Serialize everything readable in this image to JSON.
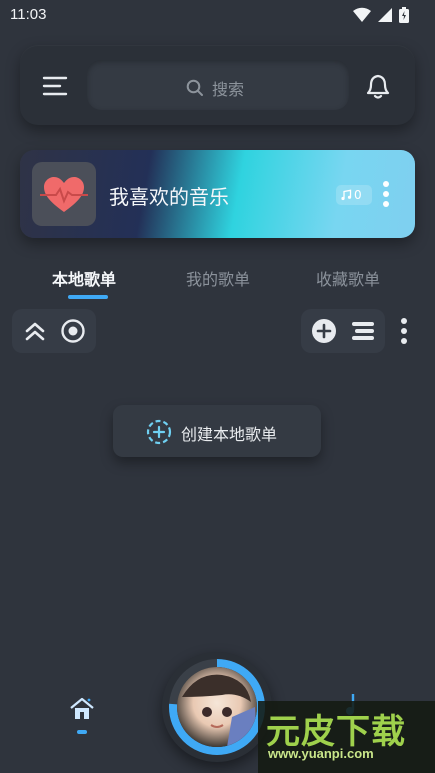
{
  "status": {
    "time": "11:03"
  },
  "header": {
    "search_placeholder": "搜索"
  },
  "favorite": {
    "title": "我喜欢的音乐",
    "count": "0"
  },
  "tabs": [
    {
      "label": "本地歌单",
      "active": true
    },
    {
      "label": "我的歌单",
      "active": false
    },
    {
      "label": "收藏歌单",
      "active": false
    }
  ],
  "create": {
    "label": "创建本地歌单"
  },
  "watermark": {
    "title": "元皮下载",
    "url": "www.yuanpi.com"
  },
  "colors": {
    "accent": "#3fa9f5",
    "background": "#2f343d",
    "card": "#2b3038",
    "heart": "#f06a6a"
  },
  "icons": [
    "wifi-icon",
    "signal-icon",
    "battery-icon",
    "menu-icon",
    "search-icon",
    "bell-icon",
    "heart-icon",
    "music-note-icon",
    "more-vertical-icon",
    "collapse-icon",
    "locate-icon",
    "add-icon",
    "list-icon",
    "add-circle-icon",
    "home-icon",
    "music-icon"
  ]
}
